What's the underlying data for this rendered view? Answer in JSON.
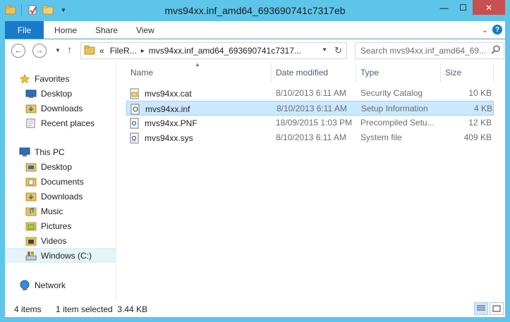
{
  "window": {
    "title": "mvs94xx.inf_amd64_693690741c7317eb",
    "controls": {
      "minimize": "—",
      "maximize": "☐",
      "close": "✕"
    }
  },
  "ribbon": {
    "file_tab": "File",
    "tabs": [
      "Home",
      "Share",
      "View"
    ]
  },
  "navigation": {
    "address_crumbs": [
      "FileR...",
      "mvs94xx.inf_amd64_693690741c7317..."
    ],
    "address_prefix": "«",
    "search_placeholder": "Search mvs94xx.inf_amd64_69..."
  },
  "nav_pane": {
    "favorites_label": "Favorites",
    "favorites": [
      "Desktop",
      "Downloads",
      "Recent places"
    ],
    "this_pc_label": "This PC",
    "this_pc": [
      "Desktop",
      "Documents",
      "Downloads",
      "Music",
      "Pictures",
      "Videos",
      "Windows (C:)"
    ],
    "network_label": "Network",
    "selected": "Windows (C:)"
  },
  "file_list": {
    "columns": [
      "Name",
      "Date modified",
      "Type",
      "Size"
    ],
    "rows": [
      {
        "name": "mvs94xx.cat",
        "date": "8/10/2013 6:11 AM",
        "type": "Security Catalog",
        "size": "10 KB",
        "icon": "security-catalog-icon"
      },
      {
        "name": "mvs94xx.inf",
        "date": "8/10/2013 6:11 AM",
        "type": "Setup Information",
        "size": "4 KB",
        "icon": "setup-info-icon",
        "selected": true
      },
      {
        "name": "mvs94xx.PNF",
        "date": "18/09/2015 1:03 PM",
        "type": "Precompiled Setu...",
        "size": "12 KB",
        "icon": "pnf-file-icon"
      },
      {
        "name": "mvs94xx.sys",
        "date": "8/10/2013 6:11 AM",
        "type": "System file",
        "size": "409 KB",
        "icon": "system-file-icon"
      }
    ]
  },
  "status_bar": {
    "items_count": "4 items",
    "selection": "1 item selected  3.44 KB"
  },
  "colors": {
    "title_bar": "#5ec5ea",
    "file_tab": "#1979ca",
    "close_button": "#c75050",
    "selection": "#cce8ff"
  }
}
